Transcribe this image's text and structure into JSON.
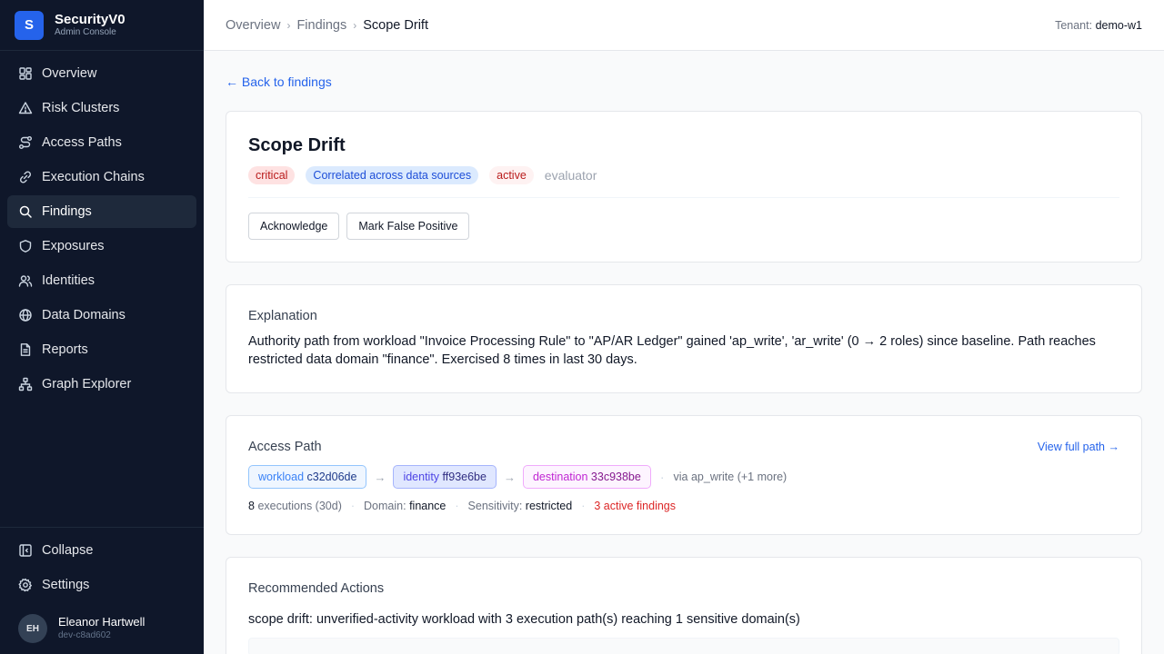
{
  "brand": {
    "logo_letter": "S",
    "name": "SecurityV0",
    "subtitle": "Admin Console"
  },
  "nav": [
    {
      "label": "Overview",
      "icon": "grid-icon"
    },
    {
      "label": "Risk Clusters",
      "icon": "warning-triangle-icon"
    },
    {
      "label": "Access Paths",
      "icon": "route-icon"
    },
    {
      "label": "Execution Chains",
      "icon": "link-icon"
    },
    {
      "label": "Findings",
      "icon": "search-icon",
      "active": true
    },
    {
      "label": "Exposures",
      "icon": "shield-icon"
    },
    {
      "label": "Identities",
      "icon": "users-icon"
    },
    {
      "label": "Data Domains",
      "icon": "globe-icon"
    },
    {
      "label": "Reports",
      "icon": "document-icon"
    },
    {
      "label": "Graph Explorer",
      "icon": "graph-icon"
    }
  ],
  "sidebar_bottom": {
    "collapse": "Collapse",
    "settings": "Settings"
  },
  "user": {
    "initials": "EH",
    "name": "Eleanor Hartwell",
    "id": "dev-c8ad602"
  },
  "breadcrumb": {
    "item1": "Overview",
    "item2": "Findings",
    "current": "Scope Drift",
    "separator": "›"
  },
  "tenant": {
    "label": "Tenant:",
    "value": "demo-w1"
  },
  "back_link": "← Back to findings",
  "finding": {
    "title": "Scope Drift",
    "badge_severity": "critical",
    "badge_correlated": "Correlated across data sources",
    "badge_status": "active",
    "source": "evaluator",
    "btn_ack": "Acknowledge",
    "btn_fp": "Mark False Positive"
  },
  "explanation": {
    "title": "Explanation",
    "text": "Authority path from workload \"Invoice Processing Rule\" to \"AP/AR Ledger\" gained 'ap_write', 'ar_write' (0 → 2 roles) since baseline. Path reaches restricted data domain \"finance\". Exercised 8 times in last 30 days."
  },
  "access_path": {
    "title": "Access Path",
    "view_full": "View full path →",
    "workload_k": "workload",
    "workload_v": "c32d06de",
    "identity_k": "identity",
    "identity_v": "ff93e6be",
    "dest_k": "destination",
    "dest_v": "33c938be",
    "arrow": "→",
    "via": "via ap_write (+1 more)",
    "exec_count": "8",
    "exec_label": "executions (30d)",
    "domain_label": "Domain:",
    "domain_value": "finance",
    "sens_label": "Sensitivity:",
    "sens_value": "restricted",
    "active_findings": "3 active findings"
  },
  "recommended": {
    "title": "Recommended Actions",
    "text": "scope drift: unverified-activity workload with 3 execution path(s) reaching 1 sensitive domain(s)"
  }
}
